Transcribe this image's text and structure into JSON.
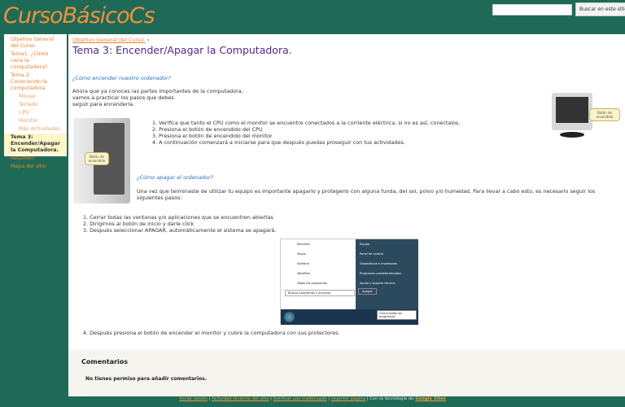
{
  "site": {
    "title": "CursoBásicoCs"
  },
  "search": {
    "placeholder": "",
    "button": "Buscar en este sitio"
  },
  "sidebar": {
    "items": [
      {
        "label": "Objetivo General del Curso."
      },
      {
        "label": "Tema1: ¿Cómo nace la computadora?"
      },
      {
        "label": "Tema 2: Conociendo la computadora."
      },
      {
        "label": "Mouse"
      },
      {
        "label": "Teclado"
      },
      {
        "label": "CPU"
      },
      {
        "label": "Monitor"
      },
      {
        "label": "Más Actividades"
      },
      {
        "label": "Tema 3: Encender/Apagar la Computadora."
      },
      {
        "label": "Resumen"
      },
      {
        "label": "Mapa del sitio"
      }
    ]
  },
  "main": {
    "breadcrumb": "Objetivo General del Curso.",
    "breadcrumb_sep": "›",
    "title": "Tema 3: Encender/Apagar la Computadora.",
    "q1": "¿Cómo encender nuestro ordenador?",
    "intro": [
      "Ahora que ya conoces las partes importantes de la computadora,",
      "vamos a practicar los pasos que debes",
      "seguir para encenderla."
    ],
    "on_steps": [
      "1. Verifica que tanto el CPU como el monitor se encuentre conectados a la corriente eléctrica, si no es así, conectalos.",
      "2. Presiona el botón de encendido del CPU",
      "3. Presiona el botón de encendido del monitor",
      "4. A continuación comenzará a iniciarse para que después puedas proseguir con tus actividades."
    ],
    "cpu_bubble": "Botón de encendido",
    "monitor_bubble": "Botón de encendido",
    "q2": "¿Cómo apagar el ordenador?",
    "off_intro": "Una vez que terminaste de utilizar tu equipo es importante apagarlo y protegerlo con alguna funda, del sol, polvo y/o humedad. Para llevar a cabo esto, es necesario seguir los siguientes pasos:",
    "off_steps": [
      "1. Cerrar todas las ventanas y/o aplicaciones que se encuentren abiertas",
      "2. Dirigirnos al botón de inicio y darle click",
      "3.  Después seleccionar APAGAR, automáticamente el sistema se apagará."
    ],
    "final_step": "4. Después presiona el botón de encender el monitor y cubre la computadora con sus protectores.",
    "startmenu": {
      "left": [
        "Recortes",
        "Skype",
        "Solitario",
        "WordPad",
        "Todos los programas"
      ],
      "right": [
        "Equipo",
        "Panel de control",
        "Dispositivos e impresoras",
        "Programas predeterminados",
        "Ayuda y soporte técnico"
      ],
      "search": "Buscar programas y archivos",
      "shutdown": "Apagar",
      "tooltip": "Cierra todos los programas"
    }
  },
  "comments": {
    "title": "Comentarios",
    "text": "No tienes permiso para añadir comentarios."
  },
  "footer": {
    "links": [
      "Iniciar sesión",
      "Actividad reciente del sitio",
      "Notificar uso inadecuado",
      "Imprimir página"
    ],
    "powered": "Con la tecnología de",
    "brand": "Google Sites"
  }
}
